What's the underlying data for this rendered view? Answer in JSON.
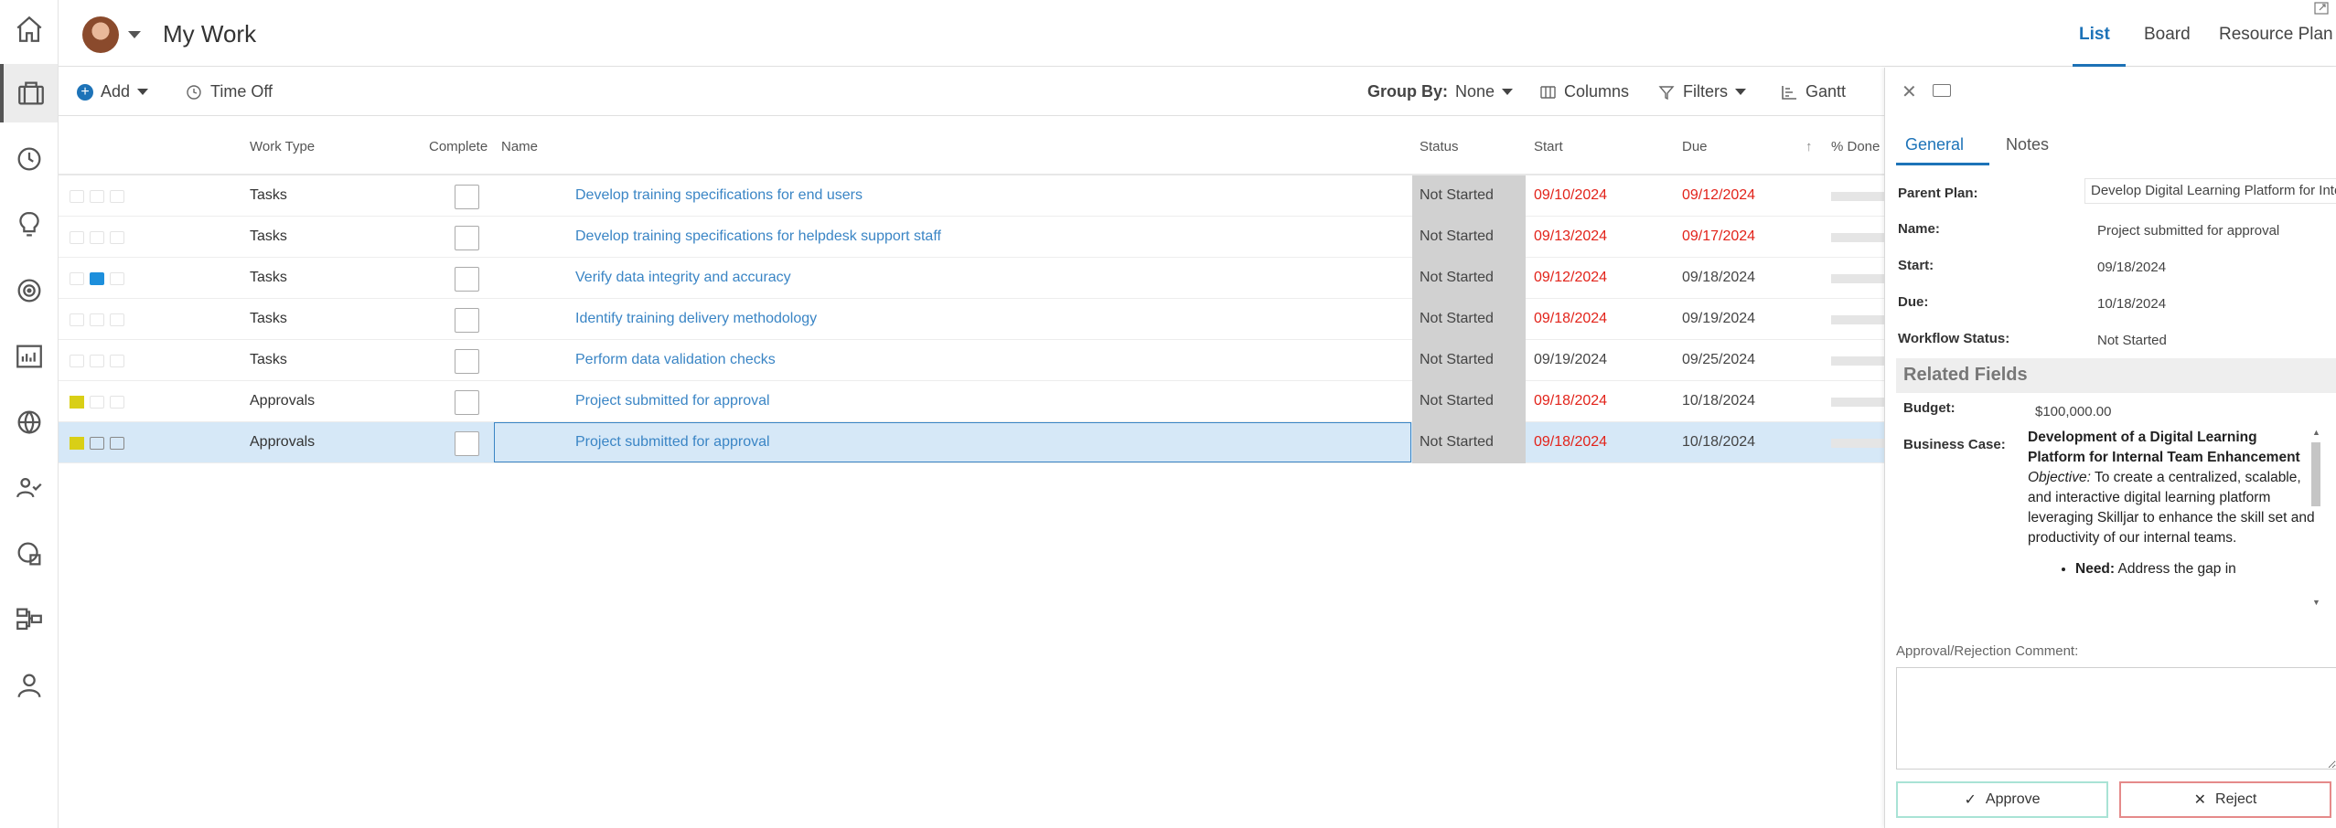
{
  "header": {
    "title": "My Work",
    "view_tabs": [
      "List",
      "Board",
      "Resource Plan"
    ]
  },
  "toolbar": {
    "add": "Add",
    "time_off": "Time Off",
    "group_by_label": "Group By:",
    "group_by_value": "None",
    "columns": "Columns",
    "filters": "Filters",
    "gantt": "Gantt"
  },
  "grid": {
    "headers": {
      "work_type": "Work Type",
      "complete": "Complete",
      "name": "Name",
      "status": "Status",
      "start": "Start",
      "due": "Due",
      "pct_done": "% Done"
    },
    "rows": [
      {
        "work_type": "Tasks",
        "name": "Develop training specifications for end users",
        "status": "Not Started",
        "start": "09/10/2024",
        "due": "09/12/2024",
        "start_overdue": true,
        "due_overdue": true,
        "indicators": [
          "none",
          "none",
          "none"
        ]
      },
      {
        "work_type": "Tasks",
        "name": "Develop training specifications for helpdesk support staff",
        "status": "Not Started",
        "start": "09/13/2024",
        "due": "09/17/2024",
        "start_overdue": true,
        "due_overdue": true,
        "indicators": [
          "none",
          "none",
          "none"
        ]
      },
      {
        "work_type": "Tasks",
        "name": "Verify data integrity and accuracy",
        "status": "Not Started",
        "start": "09/12/2024",
        "due": "09/18/2024",
        "start_overdue": true,
        "due_overdue": false,
        "indicators": [
          "none",
          "comment",
          "none"
        ]
      },
      {
        "work_type": "Tasks",
        "name": "Identify training delivery methodology",
        "status": "Not Started",
        "start": "09/18/2024",
        "due": "09/19/2024",
        "start_overdue": true,
        "due_overdue": false,
        "indicators": [
          "none",
          "none",
          "none"
        ]
      },
      {
        "work_type": "Tasks",
        "name": "Perform data validation checks",
        "status": "Not Started",
        "start": "09/19/2024",
        "due": "09/25/2024",
        "start_overdue": false,
        "due_overdue": false,
        "indicators": [
          "none",
          "none",
          "none"
        ]
      },
      {
        "work_type": "Approvals",
        "name": "Project submitted for approval",
        "status": "Not Started",
        "start": "09/18/2024",
        "due": "10/18/2024",
        "start_overdue": true,
        "due_overdue": false,
        "indicators": [
          "note",
          "none",
          "none"
        ]
      },
      {
        "work_type": "Approvals",
        "name": "Project submitted for approval",
        "status": "Not Started",
        "start": "09/18/2024",
        "due": "10/18/2024",
        "start_overdue": true,
        "due_overdue": false,
        "selected": true,
        "indicators": [
          "note",
          "comment-outline",
          "card"
        ]
      }
    ]
  },
  "panel": {
    "tabs": [
      "General",
      "Notes"
    ],
    "fields": {
      "parent_plan_label": "Parent Plan:",
      "parent_plan_value": "Develop Digital Learning Platform for Internal",
      "name_label": "Name:",
      "name_value": "Project submitted for approval",
      "start_label": "Start:",
      "start_value": "09/18/2024",
      "due_label": "Due:",
      "due_value": "10/18/2024",
      "workflow_label": "Workflow Status:",
      "workflow_value": "Not Started"
    },
    "related_title": "Related Fields",
    "budget_label": "Budget:",
    "budget_value": "$100,000.00",
    "business_case_label": "Business Case:",
    "business_case": {
      "title": "Development of a Digital Learning Platform for Internal Team Enhancement",
      "objective_label": "Objective:",
      "objective_text": " To create a centralized, scalable, and interactive digital learning platform leveraging Skilljar to enhance the skill set and productivity of our internal teams.",
      "need_label": "Need:",
      "need_text": " Address the gap in"
    },
    "comment_label": "Approval/Rejection Comment:",
    "approve": "Approve",
    "reject": "Reject"
  },
  "colors": {
    "accent": "#1d73b8",
    "overdue": "#e2231a",
    "selected_row": "#d6e8f7",
    "status_bg": "#d1d1d1",
    "note_yellow": "#d9cf16"
  }
}
